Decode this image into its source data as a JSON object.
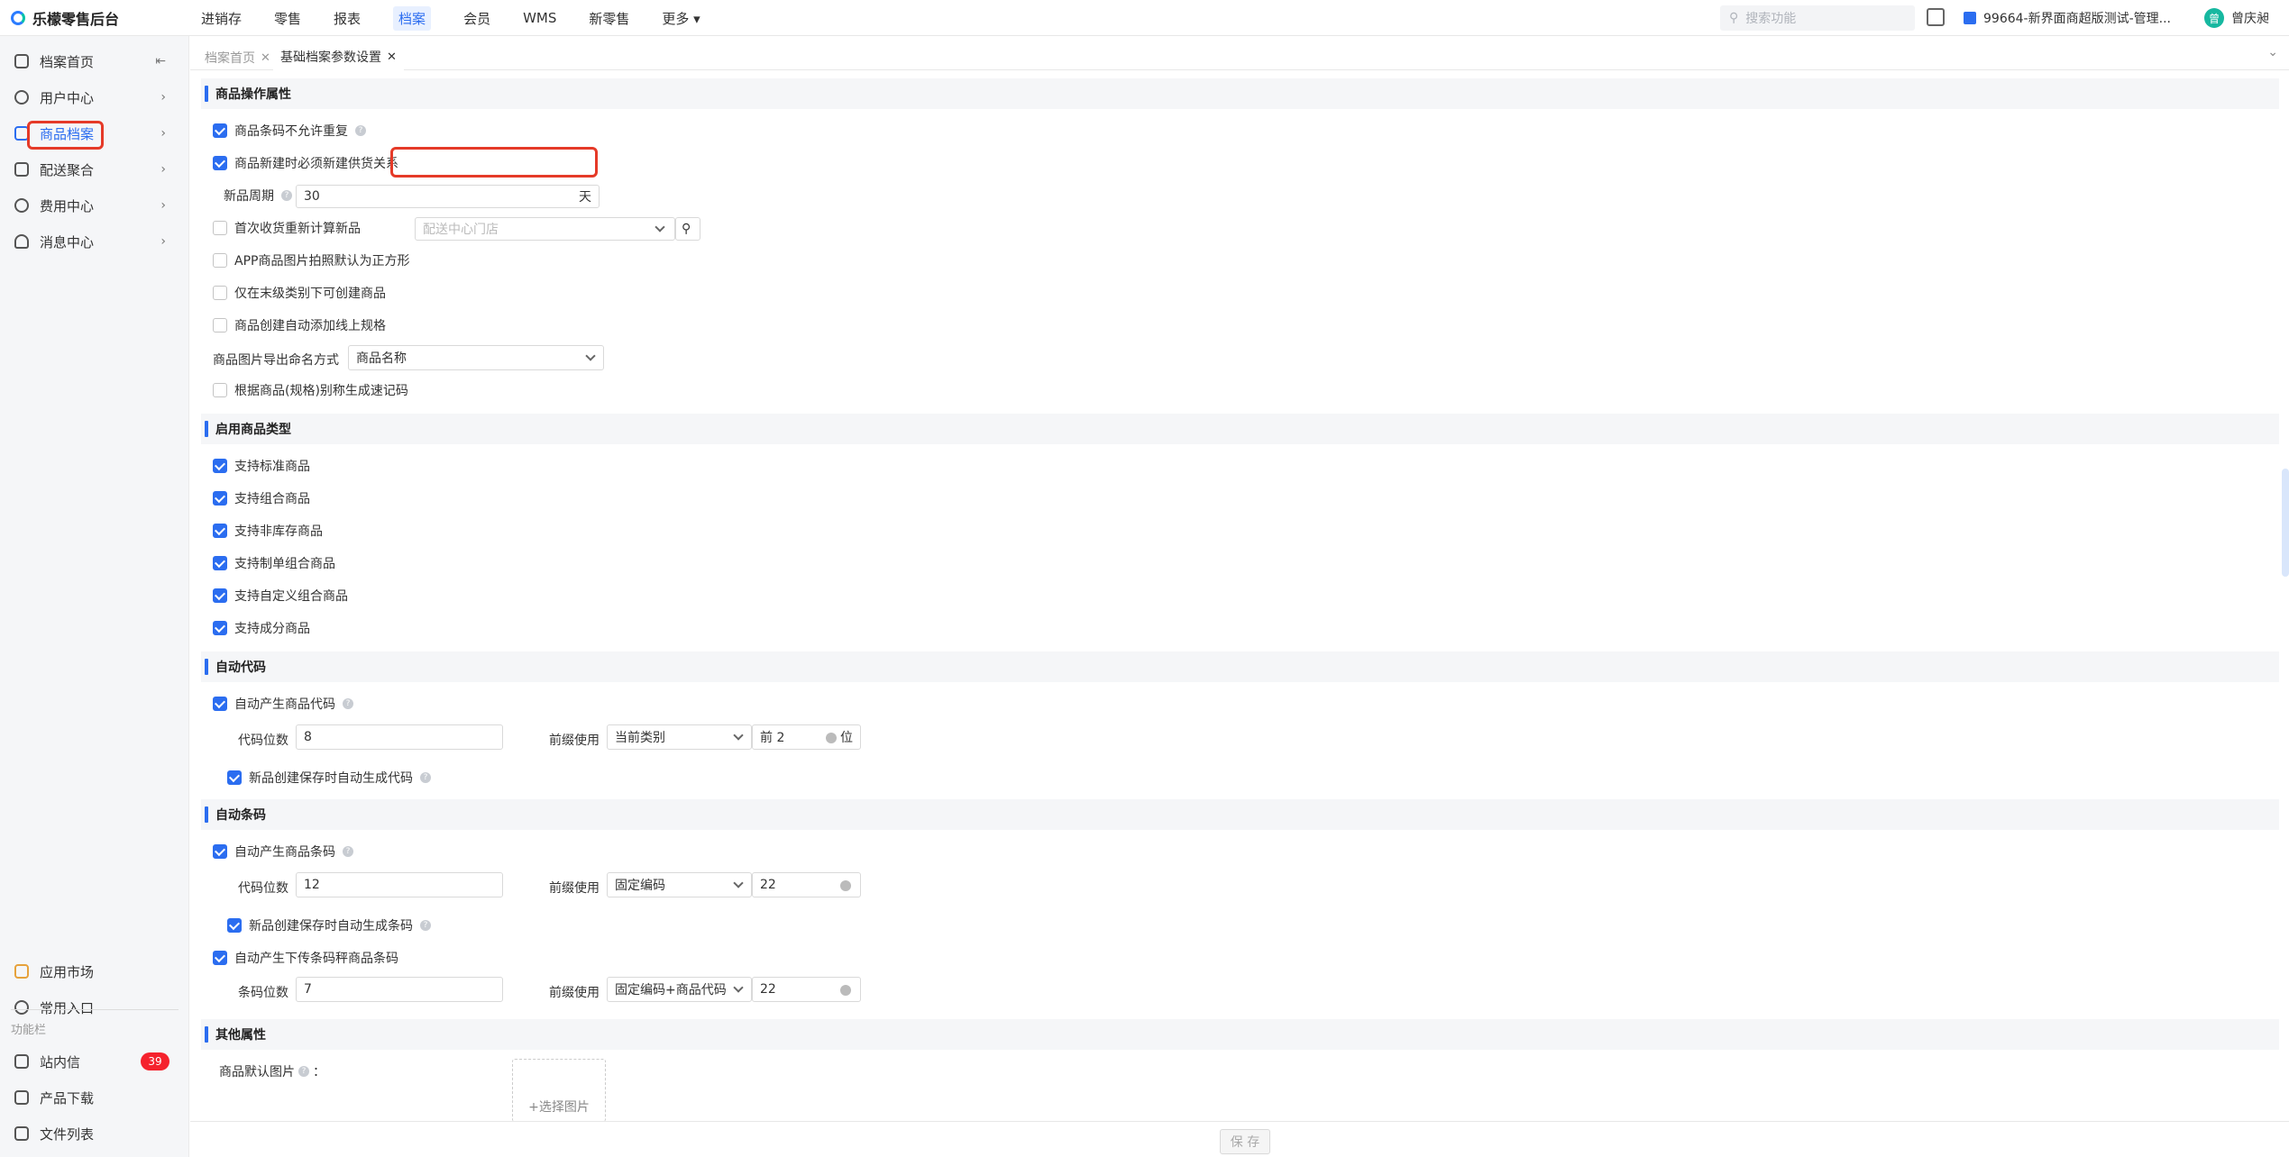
{
  "app": {
    "title": "乐檬零售后台"
  },
  "topnav": [
    {
      "label": "进销存"
    },
    {
      "label": "零售"
    },
    {
      "label": "报表"
    },
    {
      "label": "档案"
    },
    {
      "label": "会员"
    },
    {
      "label": "WMS"
    },
    {
      "label": "新零售"
    },
    {
      "label": "更多 ▾"
    }
  ],
  "search": {
    "placeholder": "搜索功能"
  },
  "store": {
    "label": "99664-新界面商超版测试-管理..."
  },
  "user": {
    "name": "曾庆昶",
    "avatar": "曾"
  },
  "sidebar": {
    "items": [
      {
        "label": "档案首页",
        "icon": "home-icon",
        "chev": "⇤"
      },
      {
        "label": "用户中心",
        "icon": "user-icon",
        "chev": "›"
      },
      {
        "label": "商品档案",
        "icon": "goods-icon",
        "chev": "›"
      },
      {
        "label": "配送聚合",
        "icon": "delivery-icon",
        "chev": "›"
      },
      {
        "label": "费用中心",
        "icon": "fee-icon",
        "chev": "›"
      },
      {
        "label": "消息中心",
        "icon": "bell-icon",
        "chev": "›"
      }
    ],
    "bottom": [
      {
        "label": "应用市场",
        "icon": "apps-icon"
      },
      {
        "label": "常用入口",
        "icon": "heart-icon"
      }
    ],
    "func_label": "功能栏",
    "func": [
      {
        "label": "站内信",
        "icon": "mail-icon"
      },
      {
        "label": "产品下载",
        "icon": "download-icon"
      },
      {
        "label": "文件列表",
        "icon": "file-list-icon"
      }
    ],
    "badge": "39"
  },
  "tabs": [
    {
      "label": "档案首页"
    },
    {
      "label": "基础档案参数设置"
    }
  ],
  "tab_close": "✕",
  "sections": {
    "s1": "商品操作属性",
    "s2": "启用商品类型",
    "s3": "自动代码",
    "s4": "自动条码",
    "s5": "其他属性"
  },
  "s1": {
    "barcode_unique": "商品条码不允许重复",
    "new_require_supplier": "商品新建时必须新建供货关系",
    "new_period_label": "新品周期",
    "new_period_value": "30",
    "new_period_unit": "天",
    "first_receive": "首次收货重新计算新品",
    "dc_store_placeholder": "配送中心门店",
    "app_square": "APP商品图片拍照默认为正方形",
    "leaf_only": "仅在末级类别下可创建商品",
    "auto_spec": "商品创建自动添加线上规格",
    "img_export_label": "商品图片导出命名方式",
    "img_export_value": "商品名称",
    "gen_code_by_alias": "根据商品(规格)别称生成速记码"
  },
  "s2": {
    "items": [
      "支持标准商品",
      "支持组合商品",
      "支持非库存商品",
      "支持制单组合商品",
      "支持自定义组合商品",
      "支持成分商品"
    ]
  },
  "s3": {
    "auto_code": "自动产生商品代码",
    "digits_label": "代码位数",
    "digits_value": "8",
    "prefix_label": "前缀使用",
    "prefix_value": "当前类别",
    "front_value": "前 2",
    "front_unit": "位",
    "auto_on_save": "新品创建保存时自动生成代码"
  },
  "s4": {
    "auto_barcode": "自动产生商品条码",
    "digits_label": "代码位数",
    "digits_value": "12",
    "prefix_label": "前缀使用",
    "prefix_value": "固定编码",
    "prefix_code": "22",
    "auto_on_save": "新品创建保存时自动生成条码",
    "scale_barcode": "自动产生下传条码秤商品条码",
    "bar_digits_label": "条码位数",
    "bar_digits_value": "7",
    "prefix2_label": "前缀使用",
    "prefix2_value": "固定编码+商品代码",
    "prefix2_code": "22"
  },
  "s5": {
    "default_img_label": "商品默认图片",
    "default_img_colon": "：",
    "choose_img": "+选择图片"
  },
  "footer": {
    "save": "保 存"
  }
}
